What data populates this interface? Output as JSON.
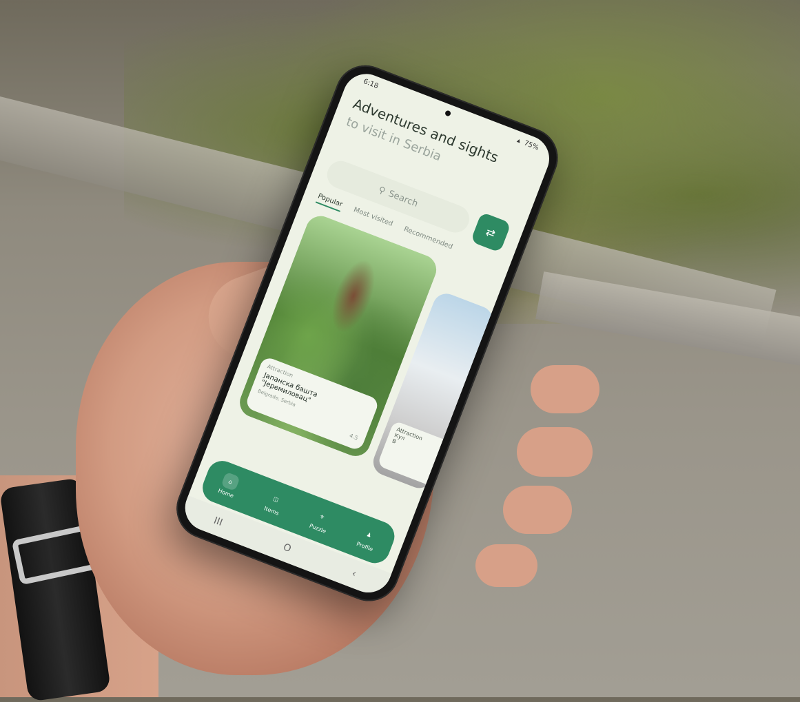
{
  "status_bar": {
    "time": "6:18",
    "battery": "75%"
  },
  "header": {
    "title": "Adventures and sights",
    "subtitle": "to visit in Serbia"
  },
  "search": {
    "placeholder": "Search"
  },
  "tabs": [
    {
      "label": "Popular",
      "active": true
    },
    {
      "label": "Most visited",
      "active": false
    },
    {
      "label": "Recommended",
      "active": false
    }
  ],
  "cards": [
    {
      "category": "Attraction",
      "name": "Јапанска башта \"Јеремиловац\"",
      "location": "Belgrade, Serbia",
      "rating": "4.5"
    },
    {
      "category": "Attraction",
      "name": "Кул",
      "location": "B"
    }
  ],
  "bottom_nav": [
    {
      "label": "Home",
      "icon": "home-icon",
      "active": true
    },
    {
      "label": "Items",
      "icon": "inbox-icon",
      "active": false
    },
    {
      "label": "Puzzle",
      "icon": "puzzle-icon",
      "active": false
    },
    {
      "label": "Profile",
      "icon": "profile-icon",
      "active": false
    }
  ],
  "system_nav": {
    "recents": "III",
    "home": "O"
  },
  "colors": {
    "accent": "#2e8b63",
    "screen_bg": "#eef2e6",
    "text_primary": "#2e3a30",
    "text_secondary": "#9aa49c"
  }
}
